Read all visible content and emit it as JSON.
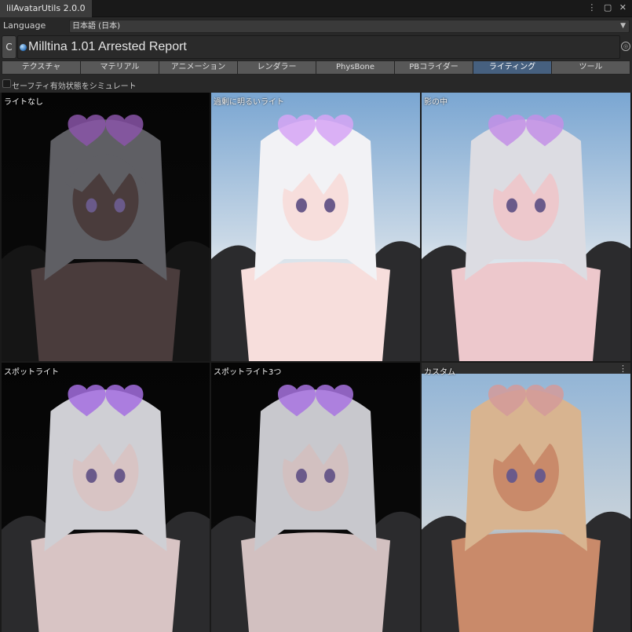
{
  "window": {
    "title": "lilAvatarUtils 2.0.0",
    "tools": "⋮ ▢ ✕"
  },
  "language": {
    "label": "Language",
    "value": "日本語 (日本)"
  },
  "avatar": {
    "refresh": "C",
    "name": "Milltina 1.01 Arrested Report"
  },
  "tabs": [
    {
      "label": "テクスチャ"
    },
    {
      "label": "マテリアル"
    },
    {
      "label": "アニメーション"
    },
    {
      "label": "レンダラー"
    },
    {
      "label": "PhysBone"
    },
    {
      "label": "PBコライダー"
    },
    {
      "label": "ライティング",
      "active": true
    },
    {
      "label": "ツール"
    }
  ],
  "safety": {
    "label": "セーフティ有効状態をシミュレート",
    "checked": false
  },
  "previews": [
    {
      "label": "ライトなし",
      "bg": "dark",
      "skin": "#4a3c3c",
      "hair": "#5f5f64",
      "lens": "#8a55a8"
    },
    {
      "label": "過剰に明るいライト",
      "bg": "sky",
      "skin": "#f7dedc",
      "hair": "#f2f2f5",
      "lens": "#d6a4f4"
    },
    {
      "label": "影の中",
      "bg": "sky",
      "skin": "#edc8cc",
      "hair": "#dcdce2",
      "lens": "#c38fe6"
    },
    {
      "label": "スポットライト",
      "bg": "dark",
      "skin": "#d8c4c4",
      "hair": "#cfcfd4",
      "lens": "#a46ee0"
    },
    {
      "label": "スポットライト3つ",
      "bg": "dark",
      "skin": "#d2c0c0",
      "hair": "#c8c8cd",
      "lens": "#a873e0"
    },
    {
      "label": "カスタム",
      "bg": "sky-warm",
      "skin": "#c98a6a",
      "hair": "#d8b490",
      "lens": "#d39a9a"
    }
  ],
  "colors": {
    "accent": "#46607f",
    "panel_bg": "#282828"
  }
}
